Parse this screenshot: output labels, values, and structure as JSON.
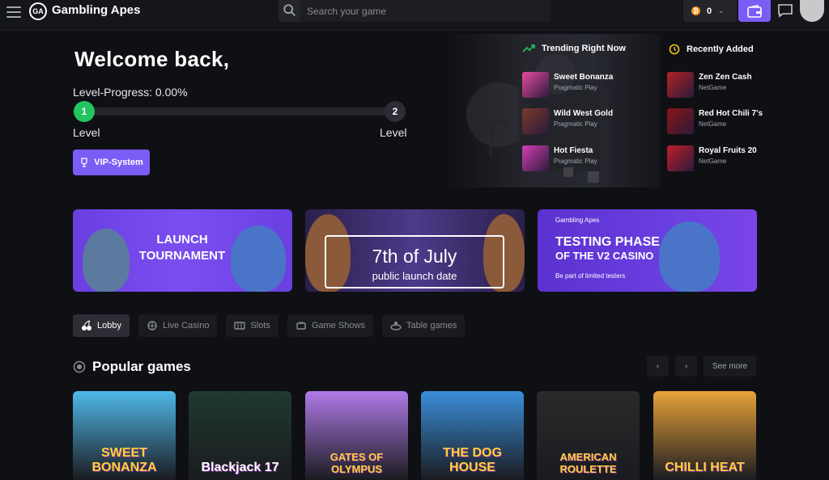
{
  "header": {
    "brand": "Gambling Apes",
    "logo_text": "GA",
    "search_placeholder": "Search your game",
    "balance": "0",
    "currency_icon": "bitcoin-icon"
  },
  "hero": {
    "welcome": "Welcome back,",
    "level_progress": "Level-Progress: 0.00%",
    "progress_percent": 0,
    "level_current": "1",
    "level_next": "2",
    "level_label_left": "Level",
    "level_label_right": "Level",
    "vip_button": "VIP-System"
  },
  "trending": {
    "heading": "Trending Right Now",
    "items": [
      {
        "title": "Sweet Bonanza",
        "provider": "Pragmatic Play",
        "color": "#e84aa0"
      },
      {
        "title": "Wild West Gold",
        "provider": "Pragmatic Play",
        "color": "#7a3a2a"
      },
      {
        "title": "Hot Fiesta",
        "provider": "Pragmatic Play",
        "color": "#d63fb6"
      }
    ]
  },
  "recent": {
    "heading": "Recently Added",
    "items": [
      {
        "title": "Zen Zen Cash",
        "provider": "NetGame",
        "color": "#b22222"
      },
      {
        "title": "Red Hot Chili 7's",
        "provider": "NetGame",
        "color": "#8b1515"
      },
      {
        "title": "Royal Fruits 20",
        "provider": "NetGame",
        "color": "#c01e2a"
      }
    ]
  },
  "banners": {
    "launch": {
      "line1": "LAUNCH",
      "line2": "TOURNAMENT"
    },
    "july": {
      "line1": "7th of July",
      "line2": "public launch date"
    },
    "testing": {
      "brand": "Gambling Apes",
      "line1": "TESTING PHASE",
      "line2": "OF THE V2 CASINO",
      "line3": "Be part of limited testers"
    }
  },
  "tabs": [
    {
      "label": "Lobby",
      "icon": "cherries-icon"
    },
    {
      "label": "Live Casino",
      "icon": "live-icon"
    },
    {
      "label": "Slots",
      "icon": "slots-icon"
    },
    {
      "label": "Game Shows",
      "icon": "game-shows-icon"
    },
    {
      "label": "Table games",
      "icon": "table-games-icon"
    }
  ],
  "popular": {
    "title": "Popular games",
    "prev": "‹",
    "next": "›",
    "see_more": "See more",
    "games": [
      {
        "title": "SWEET BONANZA",
        "bg": "#4fb8e8"
      },
      {
        "title": "Blackjack 17",
        "bg": "#1f3a2e"
      },
      {
        "title": "GATES OF OLYMPUS",
        "bg": "#b07ae8"
      },
      {
        "title": "THE DOG HOUSE",
        "bg": "#3a8ed8"
      },
      {
        "title": "AMERICAN ROULETTE",
        "bg": "#2a2a2a"
      },
      {
        "title": "CHILLI HEAT",
        "bg": "#e8a23a"
      }
    ]
  },
  "colors": {
    "accent": "#7b5cf5",
    "level_green": "#22c55e",
    "bg": "#0f1014"
  }
}
